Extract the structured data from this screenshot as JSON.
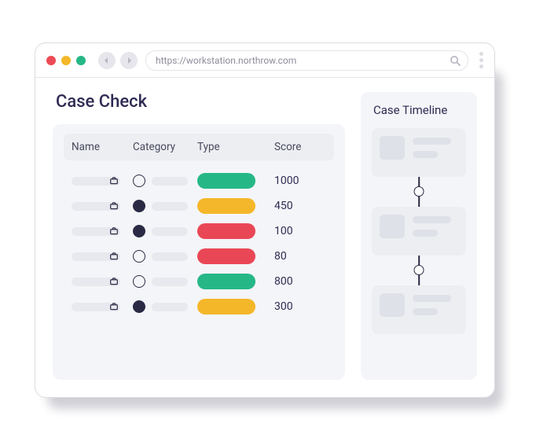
{
  "browser": {
    "url": "https://workstation.northrow.com"
  },
  "page": {
    "title": "Case Check"
  },
  "table": {
    "columns": [
      "Name",
      "Category",
      "Type",
      "Score"
    ],
    "rows": [
      {
        "categoryFilled": false,
        "type": "green",
        "score": "1000"
      },
      {
        "categoryFilled": true,
        "type": "yellow",
        "score": "450"
      },
      {
        "categoryFilled": true,
        "type": "red",
        "score": "100"
      },
      {
        "categoryFilled": false,
        "type": "red",
        "score": "80"
      },
      {
        "categoryFilled": false,
        "type": "green",
        "score": "800"
      },
      {
        "categoryFilled": true,
        "type": "yellow",
        "score": "300"
      }
    ]
  },
  "timeline": {
    "title": "Case Timeline",
    "items": [
      {},
      {},
      {}
    ]
  }
}
